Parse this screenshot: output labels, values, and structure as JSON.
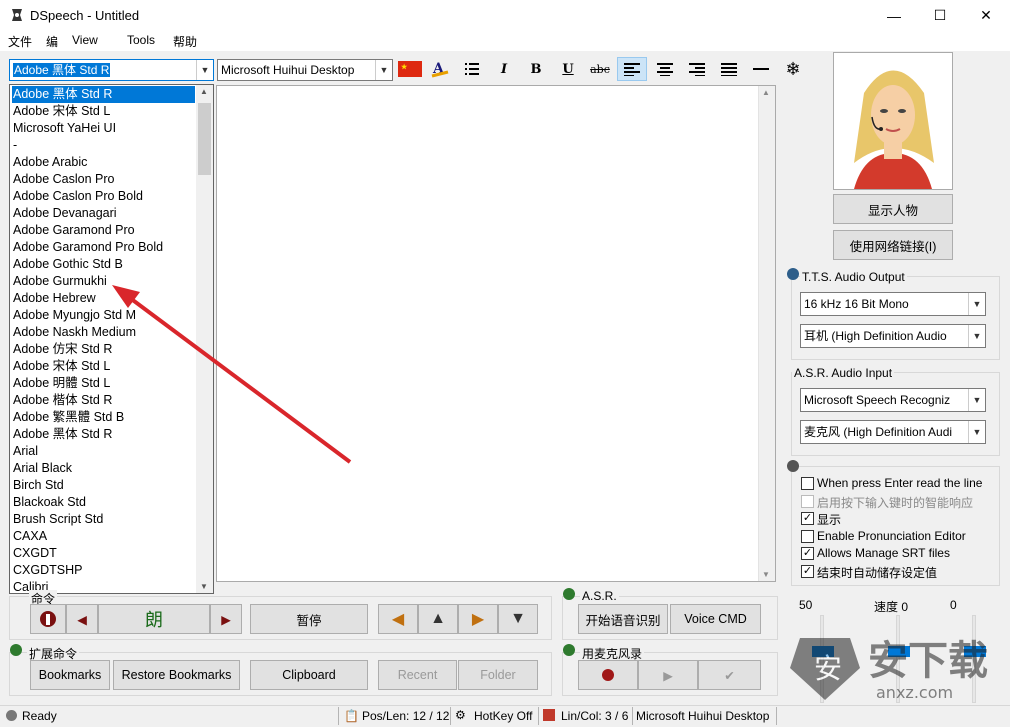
{
  "window": {
    "title": "DSpeech - Untitled",
    "min": "—",
    "max": "☐",
    "close": "✕"
  },
  "menu": [
    "文件",
    "编",
    "View",
    "Tools",
    "帮助"
  ],
  "toolbar": {
    "font_value": "Adobe 黑体 Std R",
    "font2_value": "Microsoft Huihui Desktop",
    "bold": "B",
    "italic": "I",
    "underline": "U",
    "strike": "abc"
  },
  "font_list": [
    "Adobe 黑体 Std R",
    "Adobe 宋体 Std L",
    "Microsoft YaHei UI",
    "-",
    "Adobe Arabic",
    "Adobe Caslon Pro",
    "Adobe Caslon Pro Bold",
    "Adobe Devanagari",
    "Adobe Garamond Pro",
    "Adobe Garamond Pro Bold",
    "Adobe Gothic Std B",
    "Adobe Gurmukhi",
    "Adobe Hebrew",
    "Adobe Myungjo Std M",
    "Adobe Naskh Medium",
    "Adobe 仿宋 Std R",
    "Adobe 宋体 Std L",
    "Adobe 明體 Std L",
    "Adobe 楷体 Std R",
    "Adobe 繁黑體 Std B",
    "Adobe 黑体 Std R",
    "Arial",
    "Arial Black",
    "Birch Std",
    "Blackoak Std",
    "Brush Script Std",
    "CAXA",
    "CXGDT",
    "CXGDTSHP",
    "Calibri"
  ],
  "right": {
    "show_character": "显示人物",
    "use_network": "使用网络链接(I)",
    "tts_title": "T.T.S. Audio Output",
    "tts_format": "16 kHz 16 Bit Mono",
    "tts_device": "耳机 (High Definition Audio",
    "asr_title": "A.S.R. Audio Input",
    "asr_engine": "Microsoft Speech Recogniz",
    "asr_device": "麦克风 (High Definition Audi",
    "options": [
      {
        "label": "When press Enter read the line",
        "checked": false,
        "disabled": false
      },
      {
        "label": "启用按下输入键时的智能响应",
        "checked": false,
        "disabled": true
      },
      {
        "label": "显示",
        "checked": true,
        "disabled": false
      },
      {
        "label": "Enable Pronunciation Editor",
        "checked": false,
        "disabled": false
      },
      {
        "label": "Allows Manage SRT files",
        "checked": true,
        "disabled": false
      },
      {
        "label": "结束时自动储存设定值",
        "checked": true,
        "disabled": false
      }
    ],
    "volume": "50",
    "speed_label": "速度 0",
    "pitch": "0"
  },
  "commands": {
    "title": "命令",
    "read": "朗",
    "pause": "暂停"
  },
  "ext": {
    "title": "扩展命令",
    "bookmarks": "Bookmarks",
    "restore": "Restore Bookmarks",
    "clipboard": "Clipboard",
    "recent": "Recent",
    "folder": "Folder"
  },
  "asr": {
    "title": "A.S.R.",
    "start": "开始语音识别",
    "voice_cmd": "Voice CMD"
  },
  "mic": {
    "title": "用麦克风录"
  },
  "status": {
    "ready": "Ready",
    "poslen": "Pos/Len: 12 / 12",
    "hotkey": "HotKey Off",
    "lincol": "Lin/Col: 3 / 6",
    "voice": "Microsoft Huihui Desktop"
  },
  "watermark": "安下载 anxz.com"
}
